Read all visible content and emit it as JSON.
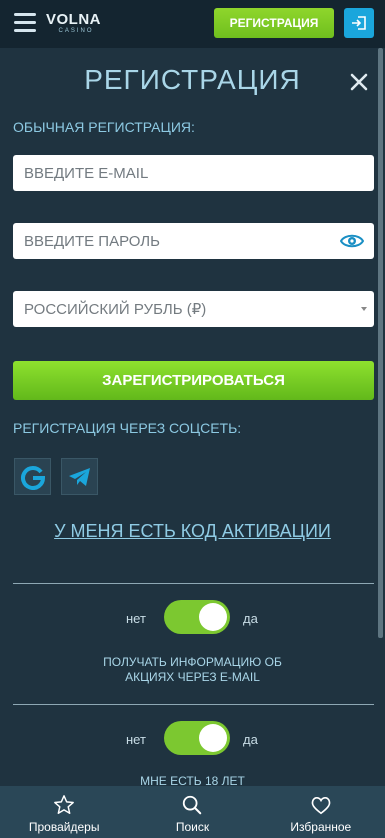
{
  "header": {
    "logo_main": "VOLNA",
    "logo_sub": "CASINO",
    "register_label": "Регистрация"
  },
  "form": {
    "title": "РЕГИСТРАЦИЯ",
    "regular_label": "Обычная регистрация:",
    "email_placeholder": "ВВЕДИТЕ E-MAIL",
    "password_placeholder": "ВВЕДИТЕ ПАРОЛЬ",
    "currency_value": "РОССИЙСКИЙ РУБЛЬ (₽)",
    "submit_label": "Зарегистрироваться",
    "social_label": "Регистрация через соцсеть:",
    "activation_link": "У меня есть код активации"
  },
  "toggles": [
    {
      "no": "нет",
      "yes": "да",
      "caption": "ПОЛУЧАТЬ ИНФОРМАЦИЮ ОБ АКЦИЯХ ЧЕРЕЗ E-MAIL",
      "on": true
    },
    {
      "no": "нет",
      "yes": "да",
      "caption": "МНЕ ЕСТЬ 18 ЛЕТ",
      "on": true
    }
  ],
  "bottom_nav": {
    "providers": "Провайдеры",
    "search": "Поиск",
    "favorites": "Избранное"
  },
  "colors": {
    "background": "#1f3340",
    "header": "#142530",
    "accent_green": "#7cc830",
    "accent_blue": "#1aa6dc",
    "nav": "#2a4757"
  },
  "icons": [
    "menu-icon",
    "login-icon",
    "close-icon",
    "eye-icon",
    "google-icon",
    "telegram-icon",
    "star-icon",
    "search-icon",
    "heart-icon"
  ]
}
